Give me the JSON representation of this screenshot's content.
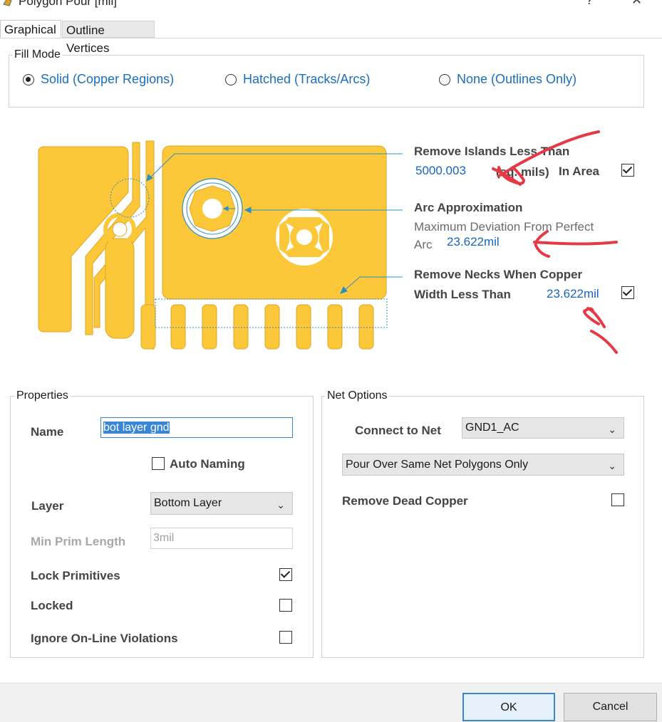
{
  "window": {
    "title": "Polygon Pour [mil]"
  },
  "tabs": [
    {
      "label": "Graphical"
    },
    {
      "label": "Outline Vertices"
    }
  ],
  "fill_mode": {
    "legend": "Fill Mode",
    "options": [
      {
        "label": "Solid (Copper Regions)",
        "selected": true
      },
      {
        "label": "Hatched (Tracks/Arcs)",
        "selected": false
      },
      {
        "label": "None (Outlines Only)",
        "selected": false
      }
    ]
  },
  "graphic": {
    "remove_islands": {
      "label": "Remove Islands Less Than",
      "value": "5000.003",
      "unit": "(sq. mils)",
      "suffix": "In Area",
      "checked": true
    },
    "arc_approx": {
      "label": "Arc Approximation",
      "desc1": "Maximum Deviation From Perfect",
      "desc2": "Arc",
      "value": "23.622mil"
    },
    "remove_necks": {
      "label1": "Remove Necks When Copper",
      "label2": "Width Less Than",
      "value": "23.622mil",
      "checked": true
    }
  },
  "properties": {
    "legend": "Properties",
    "name_label": "Name",
    "name_value": "bot layer gnd",
    "auto_naming_label": "Auto Naming",
    "auto_naming_checked": false,
    "layer_label": "Layer",
    "layer_value": "Bottom Layer",
    "min_prim_label": "Min Prim Length",
    "min_prim_value": "3mil",
    "lock_primitives_label": "Lock Primitives",
    "lock_primitives_checked": true,
    "locked_label": "Locked",
    "locked_checked": false,
    "ignore_label": "Ignore On-Line Violations",
    "ignore_checked": false
  },
  "net_options": {
    "legend": "Net Options",
    "connect_label": "Connect to Net",
    "connect_value": "GND1_AC",
    "pour_value": "Pour Over Same Net Polygons Only",
    "dead_copper_label": "Remove Dead Copper",
    "dead_copper_checked": false
  },
  "buttons": {
    "ok": "OK",
    "cancel": "Cancel"
  },
  "colors": {
    "copper": "#fcc83a",
    "leader": "#2a8fc4",
    "annotation": "#e63946",
    "link_blue": "#1565c0"
  }
}
